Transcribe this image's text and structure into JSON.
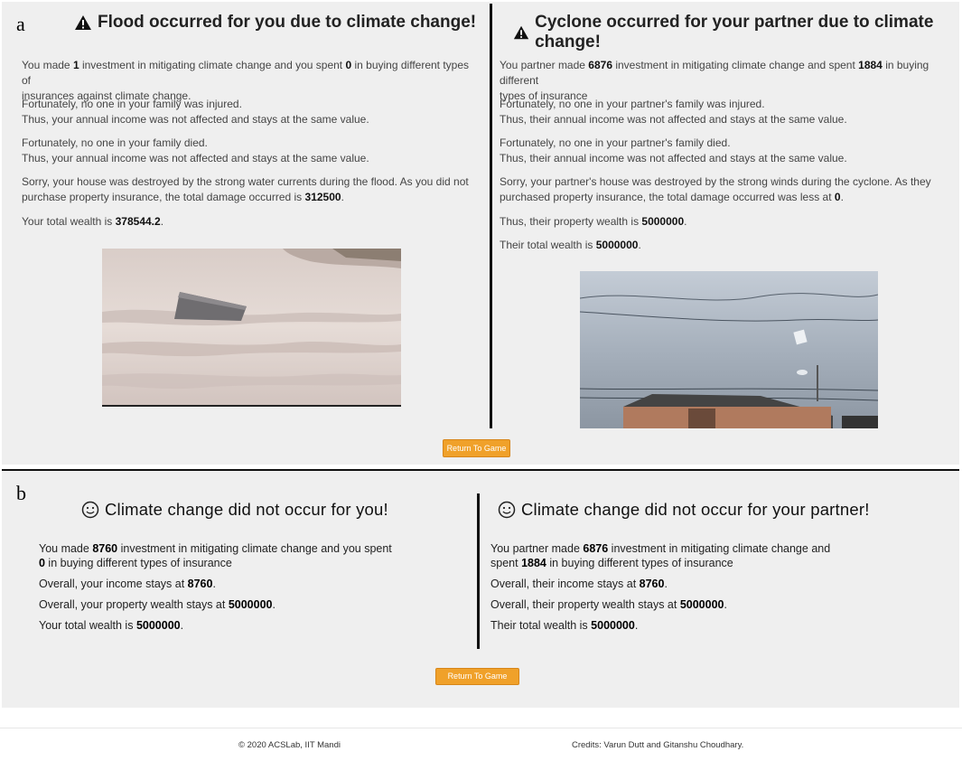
{
  "panel_a": {
    "letter": "a",
    "left": {
      "title": "Flood occurred for you due to climate change!",
      "p1": {
        "t1": "You made ",
        "v1": "1",
        "t2": " investment in mitigating climate change and you spent ",
        "v2": "0",
        "t3": " in buying different types of",
        "t4": "insurances against climate change."
      },
      "p2a": "Fortunately, no one in your family was injured.",
      "p2b": "Thus, your annual income was not affected and stays at the same value.",
      "p3a": "Fortunately, no one in your family died.",
      "p3b": "Thus, your annual income was not affected and stays at the same value.",
      "p4": {
        "t1": "Sorry, your house was destroyed by the strong water currents during the flood. As you did not",
        "t2": "purchase property insurance, the total damage occurred is ",
        "v": "312500",
        "t3": "."
      },
      "p5": {
        "t1": "Your total wealth is ",
        "v": "378544.2",
        "t2": "."
      }
    },
    "right": {
      "title": "Cyclone occurred for your partner due to climate change!",
      "p1": {
        "t1": "You partner made ",
        "v1": "6876",
        "t2": " investment in mitigating climate change and spent ",
        "v2": "1884",
        "t3": " in buying different",
        "t4": "types of insurance"
      },
      "p2a": "Fortunately, no one in your partner's family was injured.",
      "p2b": "Thus, their annual income was not affected and stays at the same value.",
      "p3a": "Fortunately, no one in your partner's family died.",
      "p3b": "Thus, their annual income was not affected and stays at the same value.",
      "p4": {
        "t1": "Sorry, your partner's house was destroyed by the strong winds during the cyclone. As they",
        "t2": "purchased property insurance, the total damage occurred was less at ",
        "v": "0",
        "t3": "."
      },
      "p5": {
        "t1": "Thus, their property wealth is ",
        "v": "5000000",
        "t2": "."
      },
      "p6": {
        "t1": "Their total wealth is ",
        "v": "5000000",
        "t2": "."
      }
    },
    "button": "Return To Game"
  },
  "panel_b": {
    "letter": "b",
    "left": {
      "title": "Climate change did not occur for you!",
      "p1": {
        "t1": "You made ",
        "v1": "8760",
        "t2": " investment in mitigating climate change and you spent",
        "v2": "0",
        "t3": " in buying different types of insurance"
      },
      "p2": {
        "t1": "Overall, your income stays at ",
        "v": "8760",
        "t2": "."
      },
      "p3": {
        "t1": "Overall, your property wealth stays at ",
        "v": "5000000",
        "t2": "."
      },
      "p4": {
        "t1": "Your total wealth is ",
        "v": "5000000",
        "t2": "."
      }
    },
    "right": {
      "title": "Climate change did not occur for your partner!",
      "p1": {
        "t1": "You partner made ",
        "v1": "6876",
        "t2": " investment in mitigating climate change and",
        "t3": "spent ",
        "v2": "1884",
        "t4": " in buying different types of insurance"
      },
      "p2": {
        "t1": "Overall, their income stays at ",
        "v": "8760",
        "t2": "."
      },
      "p3": {
        "t1": "Overall, their property wealth stays at ",
        "v": "5000000",
        "t2": "."
      },
      "p4": {
        "t1": "Their total wealth is ",
        "v": "5000000",
        "t2": "."
      }
    },
    "button": "Return To Game"
  },
  "footer": {
    "copyright": "© 2020 ACSLab, IIT Mandi",
    "credits": "Credits: Varun Dutt and Gitanshu Choudhary."
  }
}
